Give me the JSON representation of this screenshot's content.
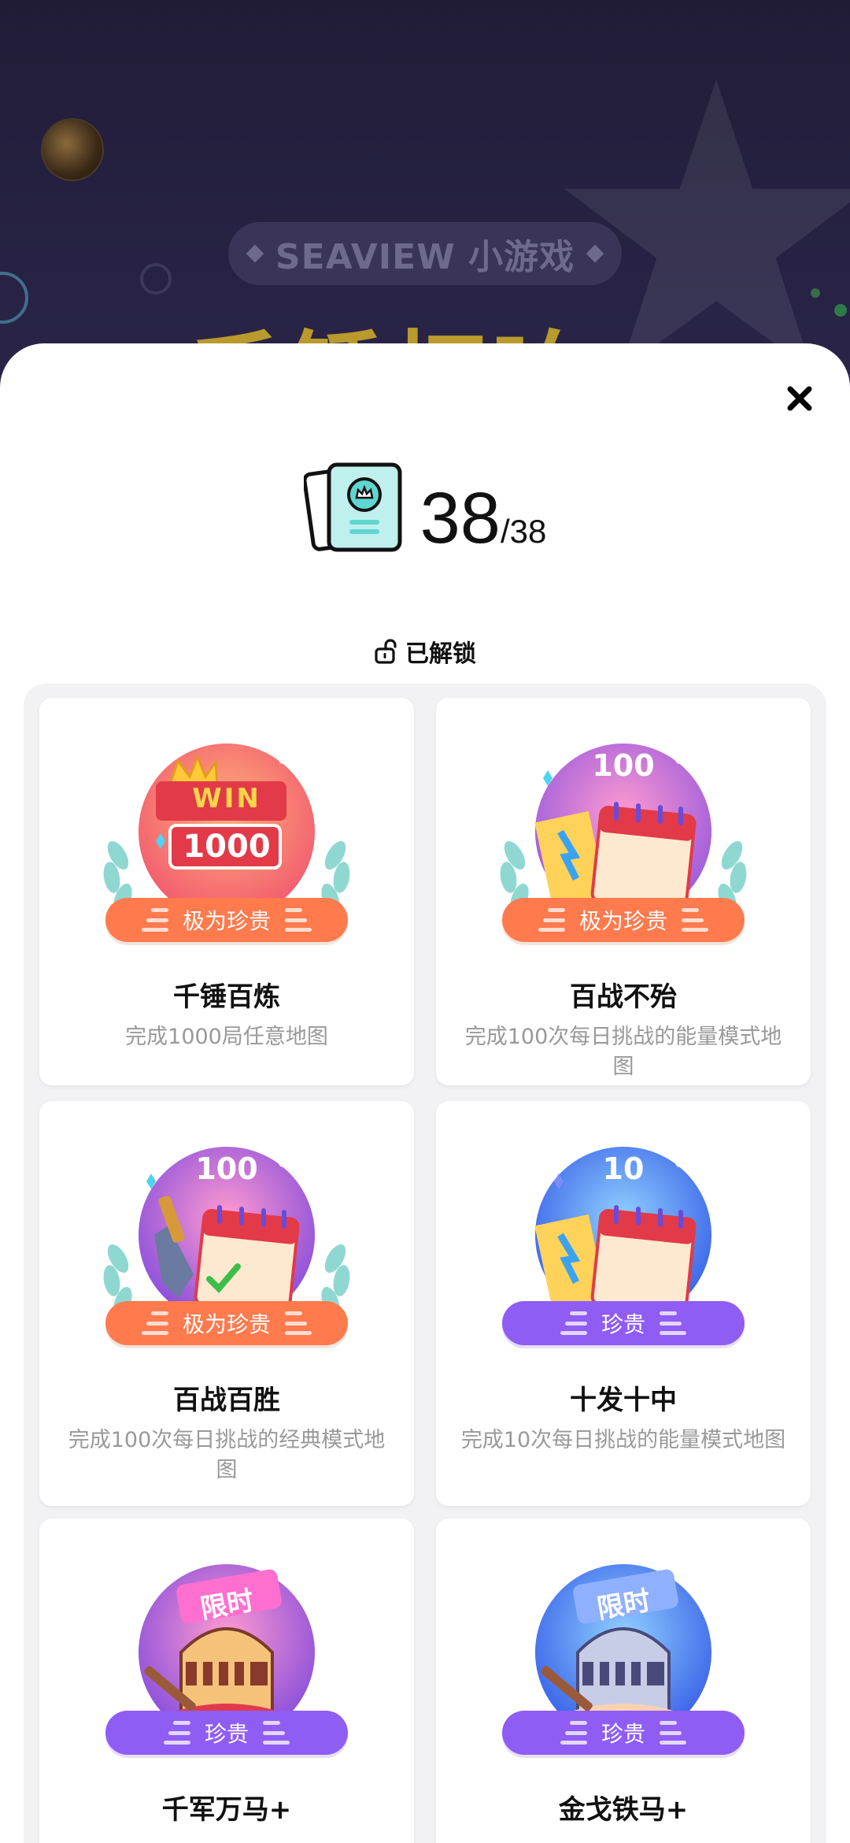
{
  "background": {
    "label": "SEAVIEW 小游戏",
    "title": "千锤打响"
  },
  "close_icon": "close-icon",
  "progress": {
    "unlocked": "38",
    "total": "/38"
  },
  "section": {
    "label": "已解锁",
    "icon": "unlock-icon"
  },
  "colors": {
    "rare_very": "#ff7a4d",
    "rare": "#8f5cf4"
  },
  "achievements": [
    {
      "title": "千锤百炼",
      "desc": "完成1000局任意地图",
      "rarity": "极为珍贵",
      "badge_text": "1000",
      "badge_top": "WIN"
    },
    {
      "title": "百战不殆",
      "desc": "完成100次每日挑战的能量模式地图",
      "rarity": "极为珍贵",
      "badge_text": "100"
    },
    {
      "title": "百战百胜",
      "desc": "完成100次每日挑战的经典模式地图",
      "rarity": "极为珍贵",
      "badge_text": "100"
    },
    {
      "title": "十发十中",
      "desc": "完成10次每日挑战的能量模式地图",
      "rarity": "珍贵",
      "badge_text": "10"
    },
    {
      "title": "千军万马+",
      "desc": "",
      "rarity": "珍贵",
      "badge_text": "限时"
    },
    {
      "title": "金戈铁马+",
      "desc": "",
      "rarity": "珍贵",
      "badge_text": "限时"
    }
  ]
}
